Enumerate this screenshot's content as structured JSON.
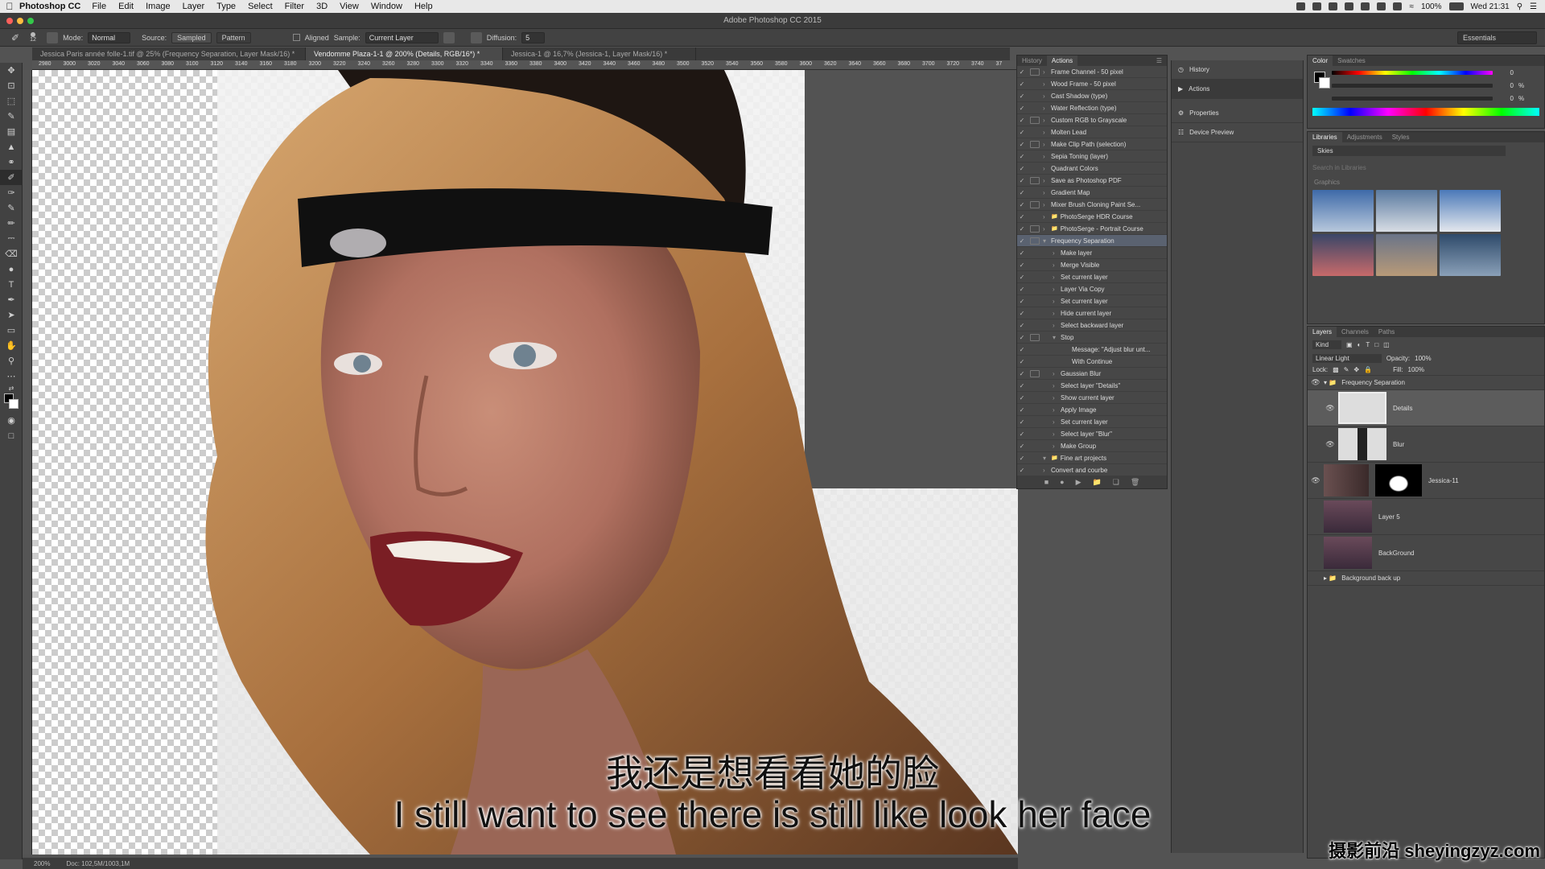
{
  "menubar": {
    "app": "Photoshop CC",
    "items": [
      "File",
      "Edit",
      "Image",
      "Layer",
      "Type",
      "Select",
      "Filter",
      "3D",
      "View",
      "Window",
      "Help"
    ],
    "battery": "100%",
    "clock": "Wed 21:31"
  },
  "titlebar": {
    "title": "Adobe Photoshop CC 2015"
  },
  "options": {
    "brush_size": "12",
    "mode_label": "Mode:",
    "mode_value": "Normal",
    "source_label": "Source:",
    "source_sampled": "Sampled",
    "source_pattern": "Pattern",
    "aligned_label": "Aligned",
    "sample_label": "Sample:",
    "sample_value": "Current Layer",
    "diffusion_label": "Diffusion:",
    "diffusion_value": "5",
    "workspace": "Essentials"
  },
  "doc_tabs": [
    "Jessica Paris année folle-1.tif @ 25% (Frequency Separation, Layer Mask/16) *",
    "Vendomme Plaza-1-1 @ 200% (Details, RGB/16*) *",
    "Jessica-1 @ 16,7% (Jessica-1, Layer Mask/16) *"
  ],
  "ruler": [
    "2980",
    "3000",
    "3020",
    "3040",
    "3060",
    "3080",
    "3100",
    "3120",
    "3140",
    "3160",
    "3180",
    "3200",
    "3220",
    "3240",
    "3260",
    "3280",
    "3300",
    "3320",
    "3340",
    "3360",
    "3380",
    "3400",
    "3420",
    "3440",
    "3460",
    "3480",
    "3500",
    "3520",
    "3540",
    "3560",
    "3580",
    "3600",
    "3620",
    "3640",
    "3660",
    "3680",
    "3700",
    "3720",
    "3740",
    "37"
  ],
  "status": {
    "zoom": "200%",
    "doc": "Doc: 102,5M/1003,1M"
  },
  "subtitles": {
    "zh": "我还是想看看她的脸",
    "en": "I still want to see there is still like look her face"
  },
  "actions_panel": {
    "tab_history": "History",
    "tab_actions": "Actions",
    "rows": [
      {
        "label": "Frame Channel - 50 pixel",
        "kind": "action",
        "dialog": true
      },
      {
        "label": "Wood Frame - 50 pixel",
        "kind": "action",
        "dialog": false
      },
      {
        "label": "Cast Shadow (type)",
        "kind": "action",
        "dialog": false
      },
      {
        "label": "Water Reflection (type)",
        "kind": "action",
        "dialog": false
      },
      {
        "label": "Custom RGB to Grayscale",
        "kind": "action",
        "dialog": true
      },
      {
        "label": "Molten Lead",
        "kind": "action",
        "dialog": false
      },
      {
        "label": "Make Clip Path (selection)",
        "kind": "action",
        "dialog": true
      },
      {
        "label": "Sepia Toning (layer)",
        "kind": "action",
        "dialog": false
      },
      {
        "label": "Quadrant Colors",
        "kind": "action",
        "dialog": false
      },
      {
        "label": "Save as Photoshop PDF",
        "kind": "action",
        "dialog": true
      },
      {
        "label": "Gradient Map",
        "kind": "action",
        "dialog": false
      },
      {
        "label": "Mixer Brush Cloning Paint Se...",
        "kind": "action",
        "dialog": true
      },
      {
        "label": "PhotoSerge HDR Course",
        "kind": "set",
        "dialog": false
      },
      {
        "label": "PhotoSerge - Portrait Course",
        "kind": "set",
        "dialog": true
      },
      {
        "label": "Frequency Separation",
        "kind": "action-open",
        "dialog": true
      },
      {
        "label": "Make layer",
        "kind": "step",
        "dialog": false
      },
      {
        "label": "Merge Visible",
        "kind": "step",
        "dialog": false
      },
      {
        "label": "Set current layer",
        "kind": "step",
        "dialog": false
      },
      {
        "label": "Layer Via Copy",
        "kind": "step",
        "dialog": false
      },
      {
        "label": "Set current layer",
        "kind": "step",
        "dialog": false
      },
      {
        "label": "Hide current layer",
        "kind": "step",
        "dialog": false
      },
      {
        "label": "Select backward layer",
        "kind": "step",
        "dialog": false
      },
      {
        "label": "Stop",
        "kind": "step-open",
        "dialog": true
      },
      {
        "label": "Message: \"Adjust blur unt...",
        "kind": "msg",
        "dialog": false
      },
      {
        "label": "With Continue",
        "kind": "msg",
        "dialog": false
      },
      {
        "label": "Gaussian Blur",
        "kind": "step",
        "dialog": true
      },
      {
        "label": "Select layer \"Details\"",
        "kind": "step",
        "dialog": false
      },
      {
        "label": "Show current layer",
        "kind": "step",
        "dialog": false
      },
      {
        "label": "Apply Image",
        "kind": "step",
        "dialog": false
      },
      {
        "label": "Set current layer",
        "kind": "step",
        "dialog": false
      },
      {
        "label": "Select layer \"Blur\"",
        "kind": "step",
        "dialog": false
      },
      {
        "label": "Make Group",
        "kind": "step",
        "dialog": false
      },
      {
        "label": "Fine art projects",
        "kind": "set-open",
        "dialog": false
      },
      {
        "label": "Convert and courbe",
        "kind": "action",
        "dialog": false
      }
    ]
  },
  "dock": [
    {
      "label": "History",
      "icon": "history-icon"
    },
    {
      "label": "Actions",
      "icon": "play-icon"
    },
    {
      "label": "Properties",
      "icon": "properties-icon"
    },
    {
      "label": "Device Preview",
      "icon": "device-preview-icon"
    }
  ],
  "color_panel": {
    "tab_color": "Color",
    "tab_swatches": "Swatches",
    "r": "0",
    "g": "0",
    "b": "0",
    "pct": "%"
  },
  "libraries": {
    "tab_libraries": "Libraries",
    "tab_adjustments": "Adjustments",
    "tab_styles": "Styles",
    "library": "Skies",
    "search_placeholder": "Search in Libraries",
    "section": "Graphics"
  },
  "layers_panel": {
    "tab_layers": "Layers",
    "tab_channels": "Channels",
    "tab_paths": "Paths",
    "filter": "Kind",
    "blend": "Linear Light",
    "opacity_label": "Opacity:",
    "opacity": "100%",
    "lock_label": "Lock:",
    "fill_label": "Fill:",
    "fill": "100%",
    "group": "Frequency Separation",
    "layers": [
      "Details",
      "Blur",
      "Jessica-11",
      "Layer 5",
      "BackGround"
    ],
    "bottom_group": "Background back up"
  },
  "watermark": "摄影前沿 sheyingzyz.com",
  "colors": {
    "accent": "#5a6270",
    "panel": "#474747",
    "app_bg": "#535353"
  }
}
